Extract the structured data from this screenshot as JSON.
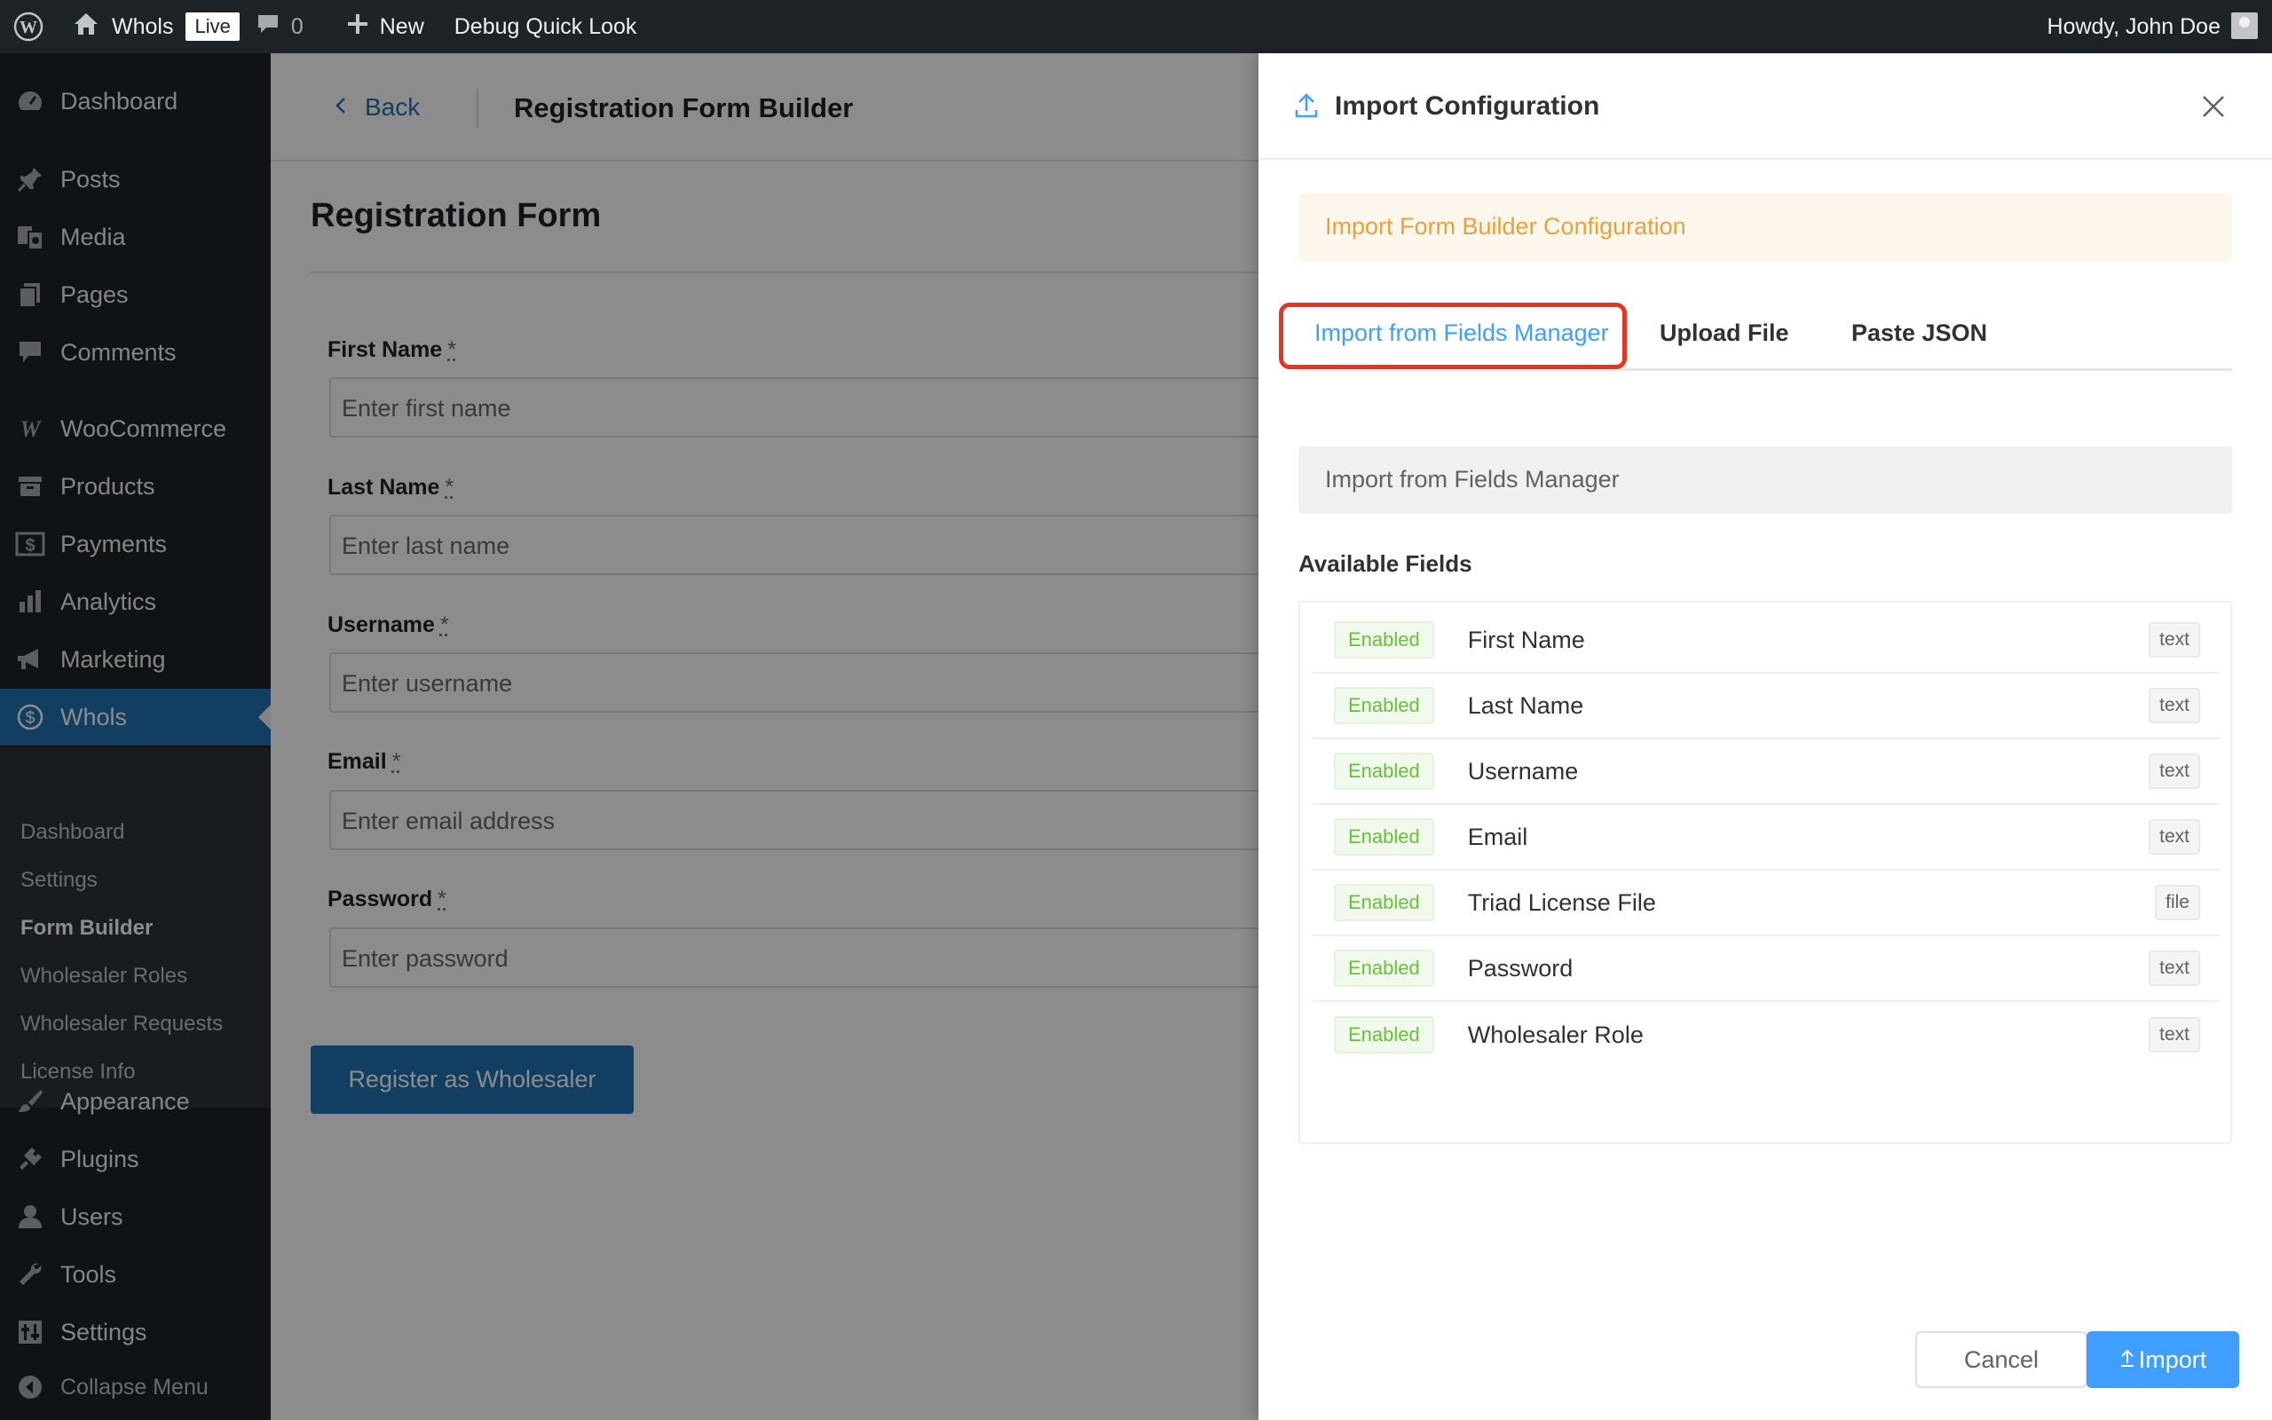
{
  "adminbar": {
    "site_name": "Whols",
    "live_badge": "Live",
    "comments_count": "0",
    "new_label": "New",
    "debug_label": "Debug Quick Look",
    "howdy": "Howdy, John Doe"
  },
  "sidebar": {
    "items": [
      {
        "label": "Dashboard",
        "icon": "dashboard-icon"
      },
      {
        "label": "Posts",
        "icon": "pin-icon"
      },
      {
        "label": "Media",
        "icon": "media-icon"
      },
      {
        "label": "Pages",
        "icon": "pages-icon"
      },
      {
        "label": "Comments",
        "icon": "comment-icon"
      },
      {
        "label": "WooCommerce",
        "icon": "woocommerce-icon"
      },
      {
        "label": "Products",
        "icon": "archive-icon"
      },
      {
        "label": "Payments",
        "icon": "dollar-square-icon"
      },
      {
        "label": "Analytics",
        "icon": "bar-chart-icon"
      },
      {
        "label": "Marketing",
        "icon": "megaphone-icon"
      },
      {
        "label": "Whols",
        "icon": "dollar-circle-icon"
      },
      {
        "label": "Appearance",
        "icon": "brush-icon"
      },
      {
        "label": "Plugins",
        "icon": "plugin-icon"
      },
      {
        "label": "Users",
        "icon": "user-icon"
      },
      {
        "label": "Tools",
        "icon": "wrench-icon"
      },
      {
        "label": "Settings",
        "icon": "settings-icon"
      },
      {
        "label": "Collapse Menu",
        "icon": "collapse-icon"
      }
    ],
    "submenu": [
      {
        "label": "Dashboard"
      },
      {
        "label": "Settings"
      },
      {
        "label": "Form Builder"
      },
      {
        "label": "Wholesaler Roles"
      },
      {
        "label": "Wholesaler Requests"
      },
      {
        "label": "License Info"
      }
    ]
  },
  "main": {
    "back_label": "Back",
    "builder_title": "Registration Form Builder",
    "form_title": "Registration Form",
    "fields": [
      {
        "label": "First Name",
        "required": "*",
        "placeholder": "Enter first name"
      },
      {
        "label": "Last Name",
        "required": "*",
        "placeholder": "Enter last name"
      },
      {
        "label": "Username",
        "required": "*",
        "placeholder": "Enter username"
      },
      {
        "label": "Email",
        "required": "*",
        "placeholder": "Enter email address"
      },
      {
        "label": "Password",
        "required": "*",
        "placeholder": "Enter password"
      }
    ],
    "submit_label": "Register as Wholesaler"
  },
  "drawer": {
    "title": "Import Configuration",
    "notice": "Import Form Builder Configuration",
    "tabs": [
      {
        "label": "Import from Fields Manager"
      },
      {
        "label": "Upload File"
      },
      {
        "label": "Paste JSON"
      }
    ],
    "import_source": "Import from Fields Manager",
    "available_title": "Available Fields",
    "available_fields": [
      {
        "status": "Enabled",
        "name": "First Name",
        "type": "text"
      },
      {
        "status": "Enabled",
        "name": "Last Name",
        "type": "text"
      },
      {
        "status": "Enabled",
        "name": "Username",
        "type": "text"
      },
      {
        "status": "Enabled",
        "name": "Email",
        "type": "text"
      },
      {
        "status": "Enabled",
        "name": "Triad License File",
        "type": "file"
      },
      {
        "status": "Enabled",
        "name": "Password",
        "type": "text"
      },
      {
        "status": "Enabled",
        "name": "Wholesaler Role",
        "type": "text"
      }
    ],
    "cancel_label": "Cancel",
    "import_label": "Import"
  },
  "colors": {
    "wp_dark": "#1d2327",
    "wp_blue": "#2271b1",
    "accent_blue": "#409eff",
    "warning": "#e6a23c",
    "success": "#67c23a",
    "highlight_red": "#e53423"
  }
}
